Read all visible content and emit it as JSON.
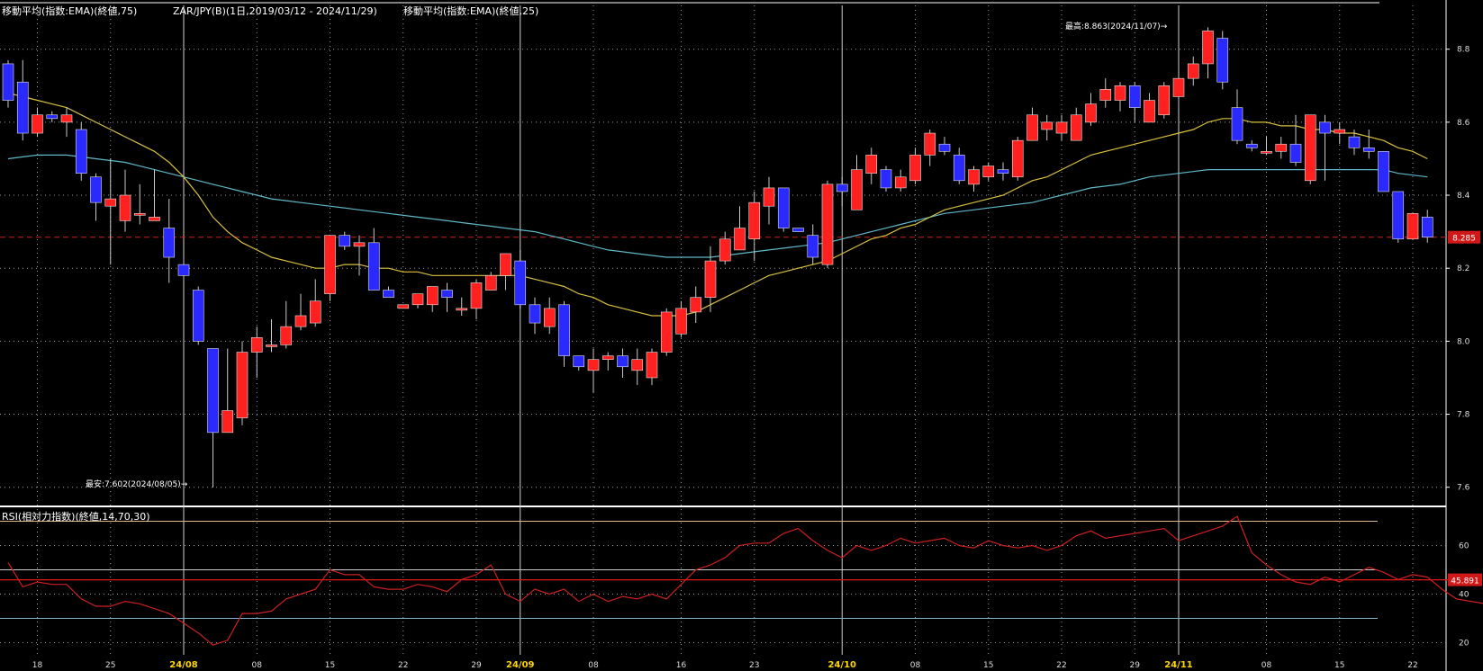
{
  "title": {
    "ema75": "移動平均(指数:EMA)(終値,75)",
    "symbol": "ZAR/JPY(B)(1日,2019/03/12 - 2024/11/29)",
    "ema25": "移動平均(指数:EMA)(終値,25)",
    "rsi": "RSI(相対力指数)(終値,14,70,30)"
  },
  "annotations": {
    "high": "最高:8.863(2024/11/07)→",
    "low": "最安:7.602(2024/08/05)→"
  },
  "colors": {
    "up": "#ff2020",
    "down": "#2a2aff",
    "ema25": "#d8c040",
    "ema75": "#5fb8c8",
    "rsi": "#cc2020",
    "current_line": "#cc2020",
    "grid": "#9a9a9a",
    "background": "#000000"
  },
  "chart_data": [
    {
      "type": "candlestick",
      "name": "ZAR/JPY daily",
      "ylim": [
        7.55,
        8.92
      ],
      "y_ticks": [
        "7.6",
        "7.8",
        "8.0",
        "8.2",
        "8.4",
        "8.6",
        "8.8"
      ],
      "current_value": "8.285",
      "x_ticks": [
        {
          "label": "18",
          "idx": 2,
          "month": false
        },
        {
          "label": "25",
          "idx": 7,
          "month": false
        },
        {
          "label": "24/08",
          "idx": 12,
          "month": true
        },
        {
          "label": "08",
          "idx": 17,
          "month": false
        },
        {
          "label": "15",
          "idx": 22,
          "month": false
        },
        {
          "label": "22",
          "idx": 27,
          "month": false
        },
        {
          "label": "29",
          "idx": 32,
          "month": false
        },
        {
          "label": "24/09",
          "idx": 35,
          "month": true
        },
        {
          "label": "08",
          "idx": 40,
          "month": false
        },
        {
          "label": "16",
          "idx": 46,
          "month": false
        },
        {
          "label": "23",
          "idx": 51,
          "month": false
        },
        {
          "label": "24/10",
          "idx": 57,
          "month": true
        },
        {
          "label": "08",
          "idx": 62,
          "month": false
        },
        {
          "label": "15",
          "idx": 67,
          "month": false
        },
        {
          "label": "22",
          "idx": 72,
          "month": false
        },
        {
          "label": "29",
          "idx": 77,
          "month": false
        },
        {
          "label": "24/11",
          "idx": 80,
          "month": true
        },
        {
          "label": "08",
          "idx": 86,
          "month": false
        },
        {
          "label": "15",
          "idx": 91,
          "month": false
        },
        {
          "label": "22",
          "idx": 96,
          "month": false
        }
      ],
      "month_lines": [
        12,
        35,
        57,
        80
      ],
      "candles": [
        [
          8.76,
          8.66,
          8.77,
          8.64
        ],
        [
          8.71,
          8.57,
          8.77,
          8.55
        ],
        [
          8.57,
          8.62,
          8.64,
          8.56
        ],
        [
          8.62,
          8.61,
          8.63,
          8.6
        ],
        [
          8.6,
          8.62,
          8.64,
          8.56
        ],
        [
          8.58,
          8.46,
          8.6,
          8.44
        ],
        [
          8.45,
          8.38,
          8.46,
          8.33
        ],
        [
          8.37,
          8.39,
          8.5,
          8.21
        ],
        [
          8.33,
          8.4,
          8.47,
          8.3
        ],
        [
          8.35,
          8.35,
          8.43,
          8.32
        ],
        [
          8.33,
          8.34,
          8.47,
          8.33
        ],
        [
          8.31,
          8.23,
          8.39,
          8.16
        ],
        [
          8.21,
          8.18,
          8.23,
          8.17
        ],
        [
          8.14,
          8.0,
          8.15,
          7.99
        ],
        [
          7.98,
          7.75,
          7.98,
          7.6
        ],
        [
          7.75,
          7.81,
          7.98,
          7.75
        ],
        [
          7.79,
          7.97,
          8.0,
          7.77
        ],
        [
          7.97,
          8.01,
          8.04,
          7.9
        ],
        [
          7.99,
          7.99,
          8.06,
          7.97
        ],
        [
          7.99,
          8.04,
          8.11,
          7.98
        ],
        [
          8.04,
          8.07,
          8.13,
          8.03
        ],
        [
          8.05,
          8.11,
          8.17,
          8.04
        ],
        [
          8.13,
          8.29,
          8.29,
          8.11
        ],
        [
          8.29,
          8.26,
          8.3,
          8.25
        ],
        [
          8.26,
          8.27,
          8.29,
          8.18
        ],
        [
          8.27,
          8.14,
          8.31,
          8.14
        ],
        [
          8.14,
          8.12,
          8.15,
          8.12
        ],
        [
          8.09,
          8.1,
          8.1,
          8.09
        ],
        [
          8.1,
          8.13,
          8.13,
          8.09
        ],
        [
          8.1,
          8.15,
          8.15,
          8.08
        ],
        [
          8.14,
          8.12,
          8.16,
          8.08
        ],
        [
          8.09,
          8.09,
          8.12,
          8.07
        ],
        [
          8.09,
          8.16,
          8.17,
          8.06
        ],
        [
          8.14,
          8.18,
          8.19,
          8.14
        ],
        [
          8.18,
          8.24,
          8.24,
          8.14
        ],
        [
          8.22,
          8.1,
          8.25,
          8.09
        ],
        [
          8.1,
          8.05,
          8.12,
          8.02
        ],
        [
          8.04,
          8.09,
          8.12,
          8.02
        ],
        [
          8.1,
          7.96,
          8.11,
          7.93
        ],
        [
          7.96,
          7.93,
          7.96,
          7.92
        ],
        [
          7.92,
          7.95,
          7.98,
          7.86
        ],
        [
          7.95,
          7.96,
          7.97,
          7.92
        ],
        [
          7.96,
          7.93,
          7.98,
          7.9
        ],
        [
          7.92,
          7.95,
          7.98,
          7.88
        ],
        [
          7.9,
          7.97,
          7.98,
          7.88
        ],
        [
          7.97,
          8.08,
          8.09,
          7.96
        ],
        [
          8.02,
          8.09,
          8.11,
          8.01
        ],
        [
          8.08,
          8.12,
          8.15,
          8.05
        ],
        [
          8.12,
          8.22,
          8.26,
          8.08
        ],
        [
          8.22,
          8.28,
          8.3,
          8.21
        ],
        [
          8.25,
          8.31,
          8.37,
          8.25
        ],
        [
          8.28,
          8.38,
          8.41,
          8.22
        ],
        [
          8.37,
          8.42,
          8.45,
          8.32
        ],
        [
          8.42,
          8.31,
          8.42,
          8.3
        ],
        [
          8.31,
          8.3,
          8.31,
          8.3
        ],
        [
          8.29,
          8.23,
          8.32,
          8.21
        ],
        [
          8.21,
          8.43,
          8.44,
          8.2
        ],
        [
          8.43,
          8.41,
          8.45,
          8.37
        ],
        [
          8.36,
          8.47,
          8.51,
          8.36
        ],
        [
          8.46,
          8.51,
          8.53,
          8.43
        ],
        [
          8.47,
          8.42,
          8.48,
          8.41
        ],
        [
          8.42,
          8.45,
          8.47,
          8.41
        ],
        [
          8.44,
          8.51,
          8.53,
          8.43
        ],
        [
          8.51,
          8.57,
          8.58,
          8.48
        ],
        [
          8.54,
          8.52,
          8.56,
          8.51
        ],
        [
          8.51,
          8.44,
          8.53,
          8.43
        ],
        [
          8.43,
          8.47,
          8.48,
          8.41
        ],
        [
          8.45,
          8.48,
          8.49,
          8.44
        ],
        [
          8.47,
          8.46,
          8.49,
          8.44
        ],
        [
          8.45,
          8.55,
          8.56,
          8.44
        ],
        [
          8.55,
          8.62,
          8.64,
          8.55
        ],
        [
          8.58,
          8.6,
          8.62,
          8.55
        ],
        [
          8.57,
          8.6,
          8.62,
          8.55
        ],
        [
          8.55,
          8.62,
          8.64,
          8.55
        ],
        [
          8.6,
          8.65,
          8.68,
          8.59
        ],
        [
          8.66,
          8.69,
          8.72,
          8.64
        ],
        [
          8.66,
          8.7,
          8.71,
          8.63
        ],
        [
          8.7,
          8.64,
          8.71,
          8.6
        ],
        [
          8.6,
          8.66,
          8.68,
          8.6
        ],
        [
          8.62,
          8.7,
          8.71,
          8.61
        ],
        [
          8.67,
          8.72,
          8.73,
          8.64
        ],
        [
          8.72,
          8.76,
          8.78,
          8.7
        ],
        [
          8.76,
          8.85,
          8.86,
          8.72
        ],
        [
          8.83,
          8.71,
          8.85,
          8.69
        ],
        [
          8.64,
          8.55,
          8.69,
          8.54
        ],
        [
          8.54,
          8.53,
          8.55,
          8.52
        ],
        [
          8.52,
          8.52,
          8.56,
          8.51
        ],
        [
          8.52,
          8.54,
          8.56,
          8.5
        ],
        [
          8.54,
          8.49,
          8.62,
          8.48
        ],
        [
          8.44,
          8.62,
          8.62,
          8.43
        ],
        [
          8.6,
          8.57,
          8.62,
          8.44
        ],
        [
          8.57,
          8.58,
          8.6,
          8.54
        ],
        [
          8.56,
          8.53,
          8.58,
          8.51
        ],
        [
          8.53,
          8.52,
          8.58,
          8.5
        ],
        [
          8.52,
          8.41,
          8.52,
          8.41
        ],
        [
          8.41,
          8.28,
          8.41,
          8.27
        ],
        [
          8.28,
          8.35,
          8.35,
          8.28
        ],
        [
          8.34,
          8.285,
          8.36,
          8.27
        ]
      ],
      "ema25": [
        8.68,
        8.67,
        8.66,
        8.65,
        8.64,
        8.62,
        8.6,
        8.58,
        8.56,
        8.54,
        8.52,
        8.49,
        8.45,
        8.4,
        8.34,
        8.3,
        8.27,
        8.25,
        8.23,
        8.22,
        8.21,
        8.2,
        8.2,
        8.21,
        8.21,
        8.2,
        8.2,
        8.19,
        8.19,
        8.18,
        8.18,
        8.18,
        8.18,
        8.18,
        8.18,
        8.18,
        8.17,
        8.16,
        8.15,
        8.13,
        8.12,
        8.1,
        8.09,
        8.08,
        8.07,
        8.07,
        8.07,
        8.08,
        8.1,
        8.12,
        8.14,
        8.16,
        8.18,
        8.19,
        8.2,
        8.21,
        8.22,
        8.24,
        8.26,
        8.28,
        8.29,
        8.31,
        8.32,
        8.34,
        8.36,
        8.37,
        8.38,
        8.39,
        8.4,
        8.42,
        8.44,
        8.45,
        8.47,
        8.49,
        8.51,
        8.52,
        8.53,
        8.54,
        8.55,
        8.56,
        8.57,
        8.58,
        8.6,
        8.61,
        8.61,
        8.6,
        8.6,
        8.59,
        8.59,
        8.58,
        8.58,
        8.57,
        8.57,
        8.56,
        8.55,
        8.53,
        8.52,
        8.5
      ],
      "ema75": [
        8.5,
        8.505,
        8.51,
        8.51,
        8.51,
        8.505,
        8.5,
        8.495,
        8.49,
        8.48,
        8.47,
        8.46,
        8.45,
        8.44,
        8.43,
        8.42,
        8.41,
        8.4,
        8.39,
        8.385,
        8.38,
        8.375,
        8.37,
        8.365,
        8.36,
        8.355,
        8.35,
        8.345,
        8.34,
        8.335,
        8.33,
        8.325,
        8.32,
        8.315,
        8.31,
        8.305,
        8.3,
        8.29,
        8.28,
        8.27,
        8.26,
        8.25,
        8.245,
        8.24,
        8.235,
        8.23,
        8.23,
        8.23,
        8.23,
        8.235,
        8.24,
        8.245,
        8.25,
        8.255,
        8.26,
        8.265,
        8.27,
        8.28,
        8.29,
        8.3,
        8.31,
        8.32,
        8.33,
        8.34,
        8.35,
        8.355,
        8.36,
        8.365,
        8.37,
        8.375,
        8.38,
        8.39,
        8.4,
        8.41,
        8.42,
        8.425,
        8.43,
        8.44,
        8.45,
        8.455,
        8.46,
        8.465,
        8.47,
        8.47,
        8.47,
        8.47,
        8.47,
        8.47,
        8.47,
        8.47,
        8.47,
        8.47,
        8.47,
        8.47,
        8.47,
        8.46,
        8.455,
        8.45
      ]
    },
    {
      "type": "line",
      "name": "RSI",
      "ylim": [
        15,
        75
      ],
      "y_ticks": [
        "20",
        "40",
        "60"
      ],
      "levels": [
        70,
        50,
        30
      ],
      "current_value": "45.891",
      "values": [
        53,
        43,
        45,
        44,
        44,
        38,
        35,
        35,
        37,
        36,
        34,
        32,
        28,
        24,
        19,
        21,
        32,
        32,
        33,
        38,
        40,
        42,
        50,
        48,
        48,
        43,
        42,
        42,
        44,
        43,
        41,
        46,
        48,
        52,
        40,
        37,
        42,
        40,
        42,
        37,
        40,
        37,
        39,
        38,
        40,
        38,
        44,
        50,
        52,
        55,
        60,
        61,
        61,
        65,
        67,
        62,
        58,
        55,
        60,
        58,
        60,
        63,
        61,
        62,
        63,
        60,
        59,
        62,
        60,
        59,
        60,
        58,
        60,
        64,
        66,
        63,
        64,
        65,
        66,
        67,
        62,
        64,
        66,
        68,
        72,
        57,
        52,
        48,
        45,
        44,
        47,
        45,
        48,
        51,
        49,
        46,
        48,
        47,
        42,
        38,
        37,
        36
      ]
    }
  ]
}
